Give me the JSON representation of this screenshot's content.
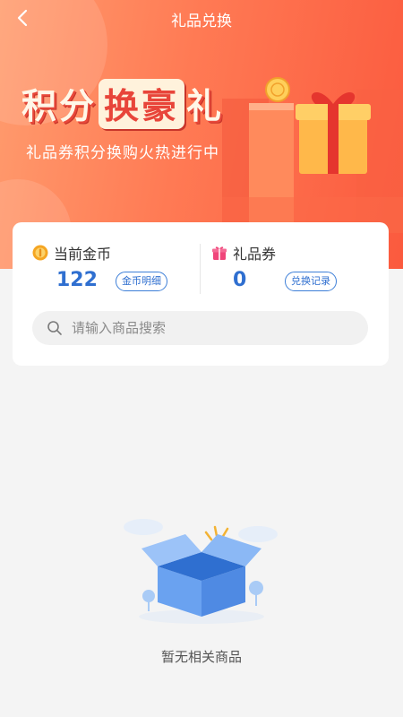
{
  "nav": {
    "title": "礼品兑换"
  },
  "banner": {
    "title_part1": "积分",
    "title_highlight": "换豪",
    "title_part2": "礼",
    "subtitle": "礼品券积分换购火热进行中"
  },
  "stats": {
    "coins": {
      "label": "当前金币",
      "value": "122",
      "button_label": "金币明细"
    },
    "vouchers": {
      "label": "礼品券",
      "value": "0",
      "button_label": "兑换记录"
    }
  },
  "search": {
    "placeholder": "请输入商品搜索"
  },
  "empty_state": {
    "message": "暂无相关商品"
  },
  "colors": {
    "hero_start": "#ff9c6e",
    "hero_end": "#fb5a3e",
    "accent_blue": "#2f6fd0",
    "coin_gold": "#f5a623",
    "gift_pink": "#f0457a"
  },
  "icons": {
    "back": "chevron-left-icon",
    "coin": "coin-icon",
    "gift": "gift-icon",
    "search": "search-icon",
    "empty": "empty-box-icon"
  }
}
